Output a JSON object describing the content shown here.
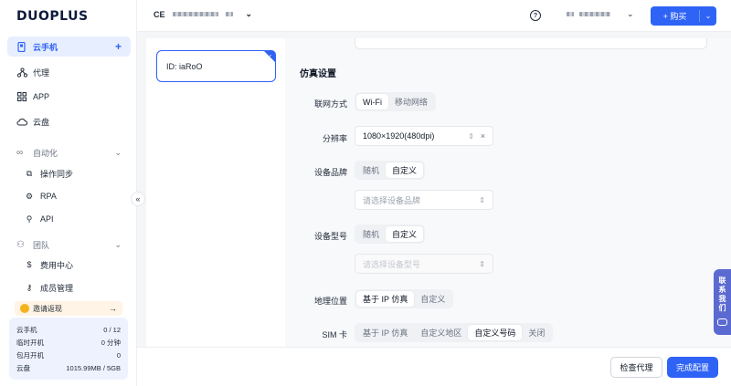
{
  "logo": "DUOPLUS",
  "sidebar": {
    "items": [
      {
        "label": "云手机",
        "icon": "phone-icon"
      },
      {
        "label": "代理",
        "icon": "proxy-icon"
      },
      {
        "label": "APP",
        "icon": "grid-icon"
      },
      {
        "label": "云盘",
        "icon": "cloud-icon"
      }
    ],
    "automation": {
      "label": "自动化",
      "items": [
        {
          "label": "操作同步"
        },
        {
          "label": "RPA"
        },
        {
          "label": "API"
        }
      ]
    },
    "team": {
      "label": "团队",
      "items": [
        {
          "label": "费用中心"
        },
        {
          "label": "成员管理"
        }
      ]
    },
    "invite_label": "邀请返现",
    "stats": [
      {
        "label": "云手机",
        "value": "0 / 12"
      },
      {
        "label": "临时开机",
        "value": "0 分钟"
      },
      {
        "label": "包月开机",
        "value": "0"
      },
      {
        "label": "云盘",
        "value": "1015.99MB / 5GB"
      }
    ]
  },
  "topbar": {
    "device_prefix": "CE",
    "buy_label": "购买"
  },
  "device_card": {
    "label": "ID: iaRoO"
  },
  "settings": {
    "section_title": "仿真设置",
    "network": {
      "label": "联网方式",
      "options": [
        "Wi-Fi",
        "移动网络"
      ],
      "selected": "Wi-Fi"
    },
    "resolution": {
      "label": "分辨率",
      "value": "1080×1920(480dpi)"
    },
    "brand": {
      "label": "设备品牌",
      "options": [
        "随机",
        "自定义"
      ],
      "selected": "自定义",
      "placeholder": "请选择设备品牌"
    },
    "model": {
      "label": "设备型号",
      "options": [
        "随机",
        "自定义"
      ],
      "selected": "自定义",
      "placeholder": "请选择设备型号"
    },
    "location": {
      "label": "地理位置",
      "options": [
        "基于 IP 仿真",
        "自定义"
      ],
      "selected": "基于 IP 仿真"
    },
    "sim": {
      "label": "SIM 卡",
      "options": [
        "基于 IP 仿真",
        "自定义地区",
        "自定义号码",
        "关闭"
      ],
      "selected": "自定义号码"
    }
  },
  "bottombar": {
    "check_proxy_label": "检查代理",
    "done_label": "完成配置"
  },
  "contact": {
    "line1": "联",
    "line2": "系",
    "line3": "我",
    "line4": "们"
  },
  "colors": {
    "accent": "#2f63f5",
    "contact_bg": "#5b6ad0"
  }
}
